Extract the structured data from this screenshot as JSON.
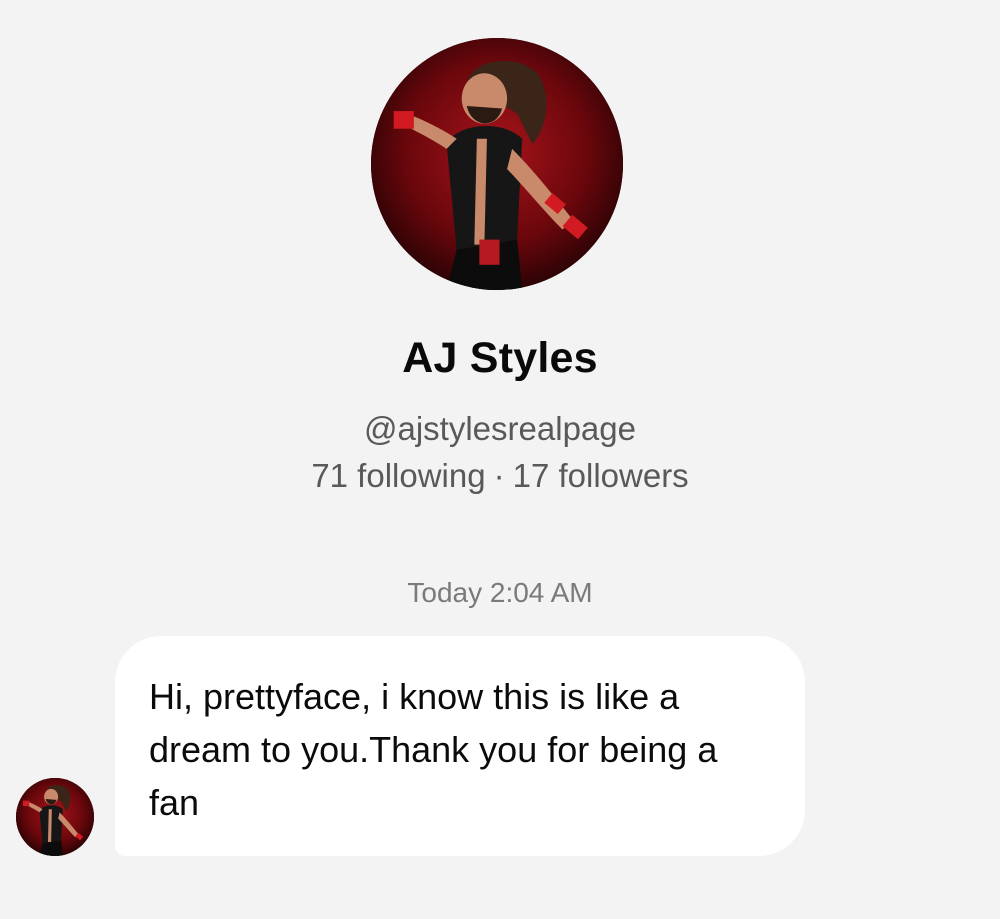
{
  "profile": {
    "name": "AJ Styles",
    "handle": "@ajstylesrealpage",
    "following": "71 following",
    "separator": "·",
    "followers": "17 followers",
    "avatar_icon": "wrestler-avatar"
  },
  "conversation": {
    "timestamp": "Today 2:04 AM",
    "messages": [
      {
        "text": "Hi, prettyface, i know this is like a dream to you.Thank you for being a fan",
        "sender_avatar_icon": "wrestler-avatar"
      }
    ]
  },
  "colors": {
    "background": "#f3f3f3",
    "bubble": "#ffffff",
    "secondary_text": "#595959",
    "timestamp_text": "#7a7a7a",
    "avatar_bg": "#8a0d12"
  }
}
